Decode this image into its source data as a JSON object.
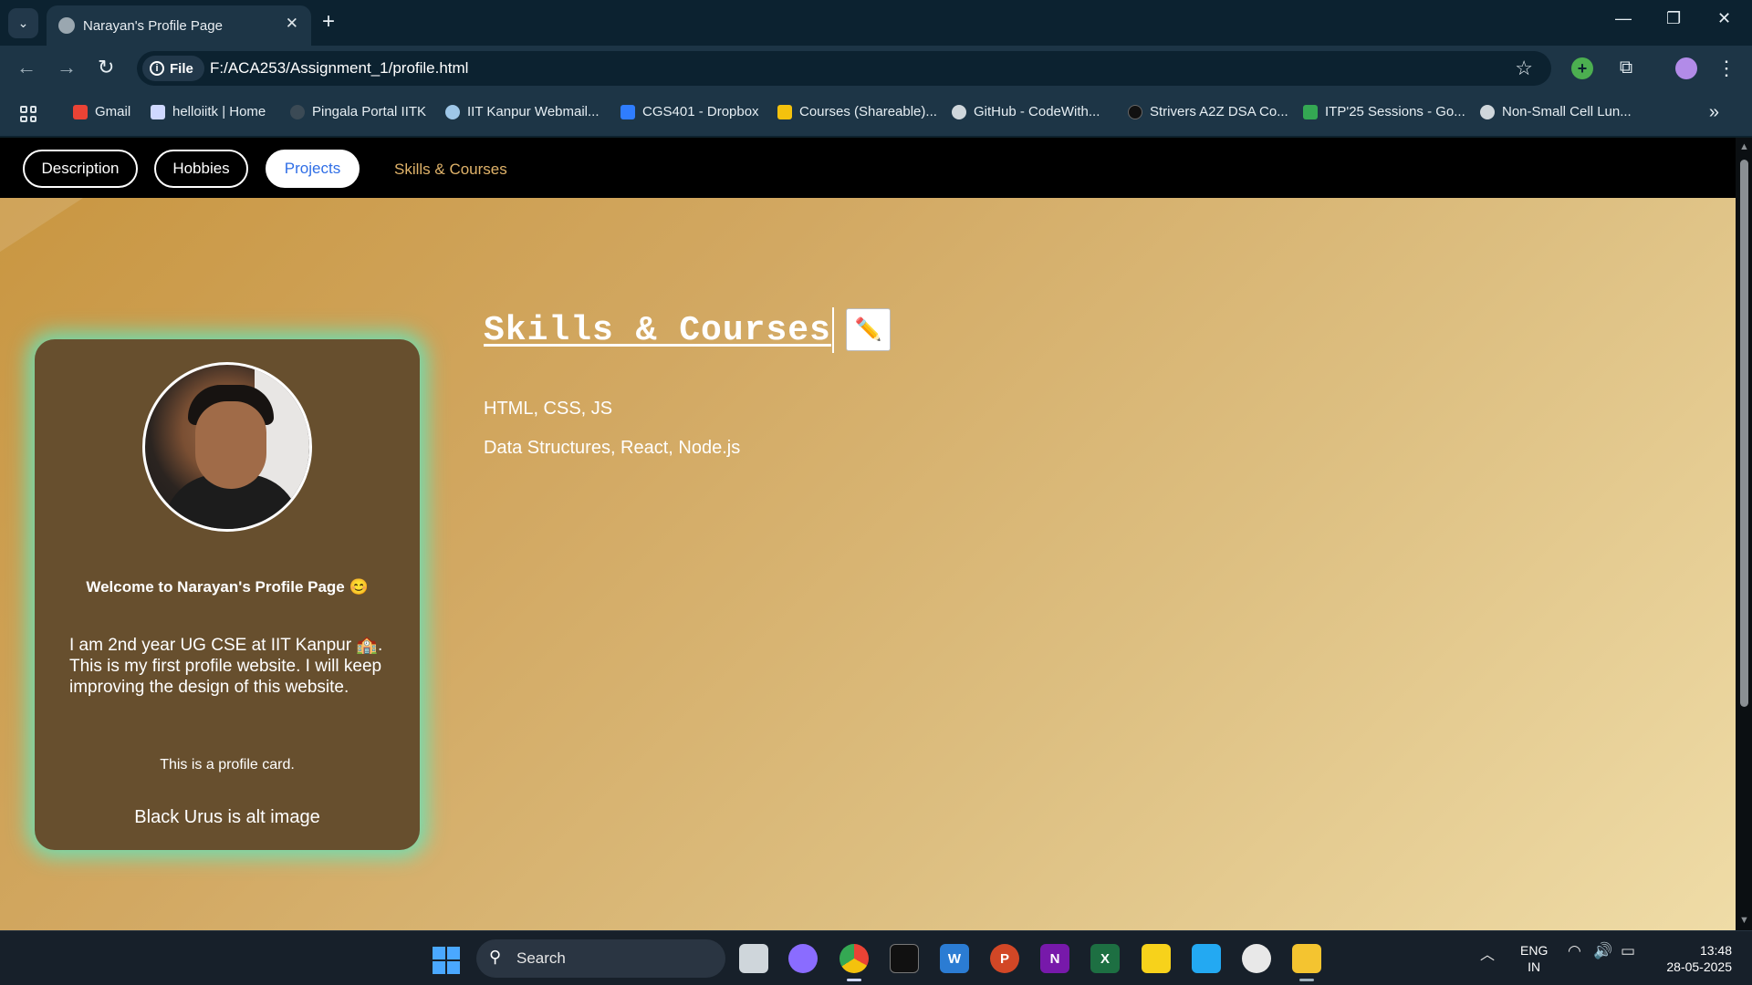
{
  "browser": {
    "tab_title": "Narayan's Profile Page",
    "close_symbol": "✕",
    "new_tab_symbol": "+",
    "file_chip_label": "File",
    "url": "F:/ACA253/Assignment_1/profile.html",
    "bookmarks": [
      {
        "label": "Gmail",
        "icon": "gmail-icon",
        "color": "#ea4335"
      },
      {
        "label": "helloiitk | Home",
        "icon": "helloiitk-icon",
        "color": "#cfd8ff"
      },
      {
        "label": "Pingala Portal IITK",
        "icon": "pingala-icon",
        "color": "#3b4a55"
      },
      {
        "label": "IIT Kanpur Webmail...",
        "icon": "webmail-icon",
        "color": "#9ec7e8"
      },
      {
        "label": "CGS401 - Dropbox",
        "icon": "dropbox-icon",
        "color": "#2f7dff"
      },
      {
        "label": "Courses (Shareable)...",
        "icon": "drive-icon",
        "color": "#f4c20d"
      },
      {
        "label": "GitHub - CodeWith...",
        "icon": "globe-icon",
        "color": "#cfd6db"
      },
      {
        "label": "Strivers A2Z DSA Co...",
        "icon": "tuf-icon",
        "color": "#111111"
      },
      {
        "label": "ITP'25 Sessions - Go...",
        "icon": "drive-icon",
        "color": "#34a853"
      },
      {
        "label": "Non-Small Cell Lun...",
        "icon": "globe-icon",
        "color": "#cfd6db"
      }
    ]
  },
  "page": {
    "nav": {
      "description": "Description",
      "hobbies": "Hobbies",
      "projects": "Projects",
      "skills": "Skills & Courses"
    },
    "card": {
      "title": "Welcome to Narayan's Profile Page 😊",
      "description": "I am 2nd year UG CSE at IIT Kanpur 🏫. This is my first profile website. I will keep improving the design of this website.",
      "note": "This is a profile card.",
      "alt_text": "Black Urus is alt image"
    },
    "skills": {
      "heading": "Skills & Courses",
      "edit_symbol": "✏️",
      "line1": "HTML, CSS, JS",
      "line2": "Data Structures, React, Node.js"
    },
    "colors": {
      "active_nav_text": "#2f6ee6",
      "card_bg": "#674f2e",
      "card_glow": "#60e6be"
    }
  },
  "taskbar": {
    "search_label": "Search",
    "language": "ENG",
    "region": "IN",
    "time": "13:48",
    "date": "28-05-2025",
    "apps": [
      {
        "name": "task-view-icon",
        "color": "#cfd6db"
      },
      {
        "name": "copilot-icon",
        "color": "#8a6cff"
      },
      {
        "name": "chrome-icon",
        "color": "#34a853"
      },
      {
        "name": "terminal-icon",
        "color": "#111111"
      },
      {
        "name": "word-icon",
        "color": "#2b7cd3",
        "letter": "W"
      },
      {
        "name": "powerpoint-icon",
        "color": "#d24726",
        "letter": "P"
      },
      {
        "name": "onenote-icon",
        "color": "#7719aa",
        "letter": "N"
      },
      {
        "name": "excel-icon",
        "color": "#1d6f42",
        "letter": "X"
      },
      {
        "name": "sticky-notes-icon",
        "color": "#f7d21b"
      },
      {
        "name": "vscode-icon",
        "color": "#23a9f2"
      },
      {
        "name": "penguin-app-icon",
        "color": "#e8e8e8"
      },
      {
        "name": "file-explorer-icon",
        "color": "#f4c430"
      }
    ]
  }
}
